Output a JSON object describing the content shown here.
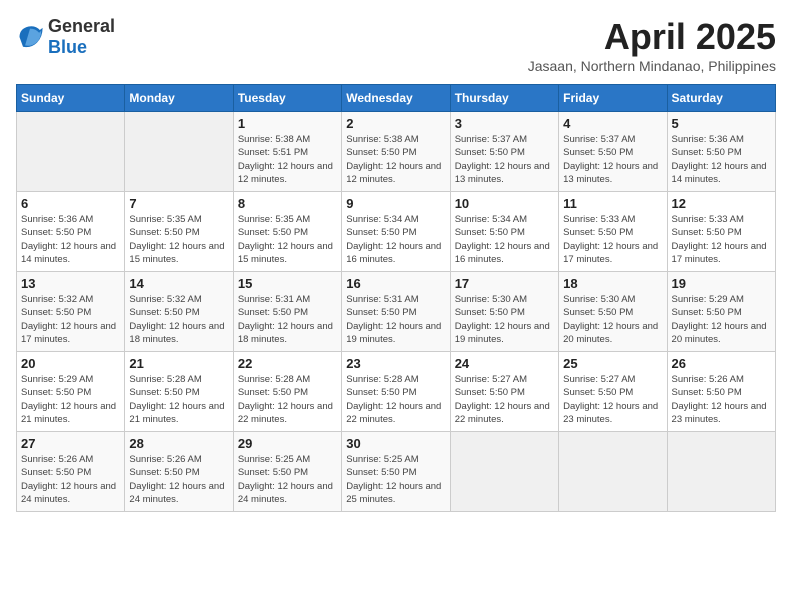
{
  "header": {
    "logo_general": "General",
    "logo_blue": "Blue",
    "month_year": "April 2025",
    "location": "Jasaan, Northern Mindanao, Philippines"
  },
  "weekdays": [
    "Sunday",
    "Monday",
    "Tuesday",
    "Wednesday",
    "Thursday",
    "Friday",
    "Saturday"
  ],
  "weeks": [
    [
      {
        "day": "",
        "info": ""
      },
      {
        "day": "",
        "info": ""
      },
      {
        "day": "1",
        "info": "Sunrise: 5:38 AM\nSunset: 5:51 PM\nDaylight: 12 hours and 12 minutes."
      },
      {
        "day": "2",
        "info": "Sunrise: 5:38 AM\nSunset: 5:50 PM\nDaylight: 12 hours and 12 minutes."
      },
      {
        "day": "3",
        "info": "Sunrise: 5:37 AM\nSunset: 5:50 PM\nDaylight: 12 hours and 13 minutes."
      },
      {
        "day": "4",
        "info": "Sunrise: 5:37 AM\nSunset: 5:50 PM\nDaylight: 12 hours and 13 minutes."
      },
      {
        "day": "5",
        "info": "Sunrise: 5:36 AM\nSunset: 5:50 PM\nDaylight: 12 hours and 14 minutes."
      }
    ],
    [
      {
        "day": "6",
        "info": "Sunrise: 5:36 AM\nSunset: 5:50 PM\nDaylight: 12 hours and 14 minutes."
      },
      {
        "day": "7",
        "info": "Sunrise: 5:35 AM\nSunset: 5:50 PM\nDaylight: 12 hours and 15 minutes."
      },
      {
        "day": "8",
        "info": "Sunrise: 5:35 AM\nSunset: 5:50 PM\nDaylight: 12 hours and 15 minutes."
      },
      {
        "day": "9",
        "info": "Sunrise: 5:34 AM\nSunset: 5:50 PM\nDaylight: 12 hours and 16 minutes."
      },
      {
        "day": "10",
        "info": "Sunrise: 5:34 AM\nSunset: 5:50 PM\nDaylight: 12 hours and 16 minutes."
      },
      {
        "day": "11",
        "info": "Sunrise: 5:33 AM\nSunset: 5:50 PM\nDaylight: 12 hours and 17 minutes."
      },
      {
        "day": "12",
        "info": "Sunrise: 5:33 AM\nSunset: 5:50 PM\nDaylight: 12 hours and 17 minutes."
      }
    ],
    [
      {
        "day": "13",
        "info": "Sunrise: 5:32 AM\nSunset: 5:50 PM\nDaylight: 12 hours and 17 minutes."
      },
      {
        "day": "14",
        "info": "Sunrise: 5:32 AM\nSunset: 5:50 PM\nDaylight: 12 hours and 18 minutes."
      },
      {
        "day": "15",
        "info": "Sunrise: 5:31 AM\nSunset: 5:50 PM\nDaylight: 12 hours and 18 minutes."
      },
      {
        "day": "16",
        "info": "Sunrise: 5:31 AM\nSunset: 5:50 PM\nDaylight: 12 hours and 19 minutes."
      },
      {
        "day": "17",
        "info": "Sunrise: 5:30 AM\nSunset: 5:50 PM\nDaylight: 12 hours and 19 minutes."
      },
      {
        "day": "18",
        "info": "Sunrise: 5:30 AM\nSunset: 5:50 PM\nDaylight: 12 hours and 20 minutes."
      },
      {
        "day": "19",
        "info": "Sunrise: 5:29 AM\nSunset: 5:50 PM\nDaylight: 12 hours and 20 minutes."
      }
    ],
    [
      {
        "day": "20",
        "info": "Sunrise: 5:29 AM\nSunset: 5:50 PM\nDaylight: 12 hours and 21 minutes."
      },
      {
        "day": "21",
        "info": "Sunrise: 5:28 AM\nSunset: 5:50 PM\nDaylight: 12 hours and 21 minutes."
      },
      {
        "day": "22",
        "info": "Sunrise: 5:28 AM\nSunset: 5:50 PM\nDaylight: 12 hours and 22 minutes."
      },
      {
        "day": "23",
        "info": "Sunrise: 5:28 AM\nSunset: 5:50 PM\nDaylight: 12 hours and 22 minutes."
      },
      {
        "day": "24",
        "info": "Sunrise: 5:27 AM\nSunset: 5:50 PM\nDaylight: 12 hours and 22 minutes."
      },
      {
        "day": "25",
        "info": "Sunrise: 5:27 AM\nSunset: 5:50 PM\nDaylight: 12 hours and 23 minutes."
      },
      {
        "day": "26",
        "info": "Sunrise: 5:26 AM\nSunset: 5:50 PM\nDaylight: 12 hours and 23 minutes."
      }
    ],
    [
      {
        "day": "27",
        "info": "Sunrise: 5:26 AM\nSunset: 5:50 PM\nDaylight: 12 hours and 24 minutes."
      },
      {
        "day": "28",
        "info": "Sunrise: 5:26 AM\nSunset: 5:50 PM\nDaylight: 12 hours and 24 minutes."
      },
      {
        "day": "29",
        "info": "Sunrise: 5:25 AM\nSunset: 5:50 PM\nDaylight: 12 hours and 24 minutes."
      },
      {
        "day": "30",
        "info": "Sunrise: 5:25 AM\nSunset: 5:50 PM\nDaylight: 12 hours and 25 minutes."
      },
      {
        "day": "",
        "info": ""
      },
      {
        "day": "",
        "info": ""
      },
      {
        "day": "",
        "info": ""
      }
    ]
  ]
}
